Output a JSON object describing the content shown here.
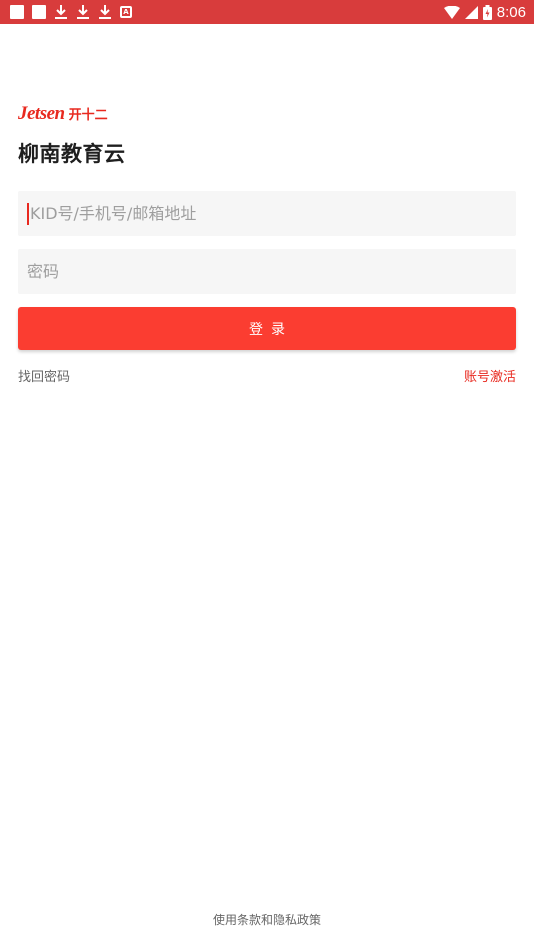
{
  "status_bar": {
    "time": "8:06",
    "notification_icons": [
      "square-icon",
      "square-icon",
      "download-icon",
      "download-icon",
      "download-icon",
      "a-badge-icon"
    ],
    "status_icons": [
      "wifi-icon",
      "signal-icon",
      "battery-icon"
    ]
  },
  "brand": {
    "logo_word": "Jetsen",
    "logo_cn": "开十二",
    "accent_color": "#e8291f"
  },
  "app_title": "柳南教育云",
  "form": {
    "account_placeholder": "KID号/手机号/邮箱地址",
    "account_value": "",
    "password_placeholder": "密码",
    "password_value": "",
    "login_label": "登录"
  },
  "links": {
    "forgot_password": "找回密码",
    "activate_account": "账号激活"
  },
  "footer": {
    "terms": "使用条款和隐私政策"
  }
}
